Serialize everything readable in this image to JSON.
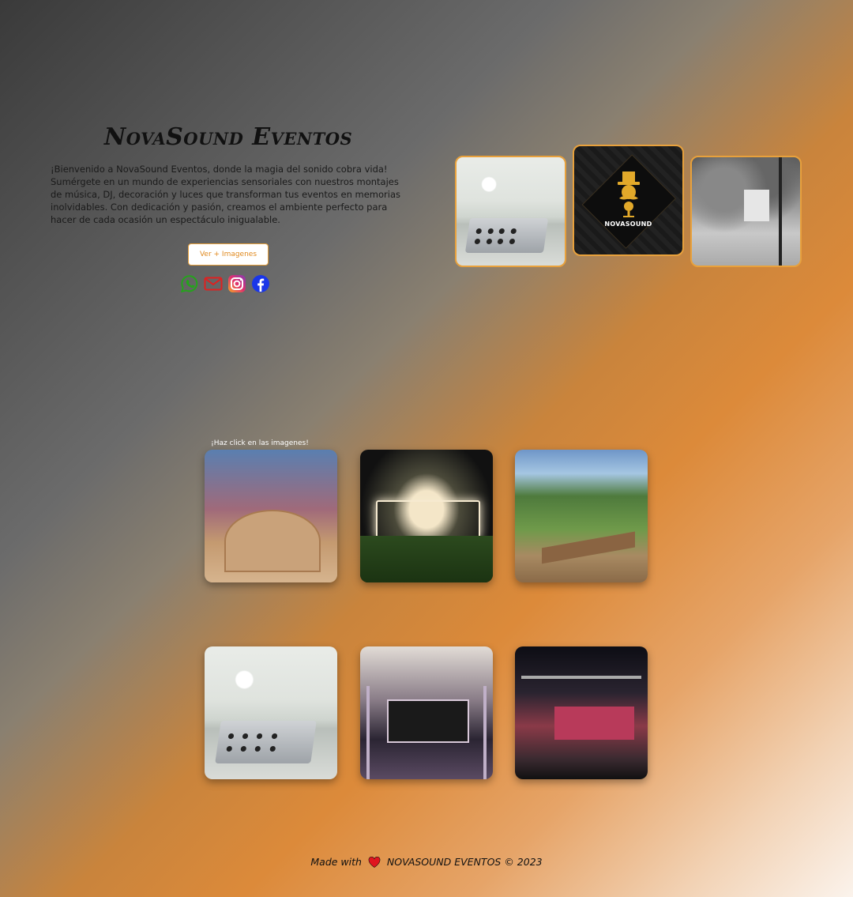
{
  "hero": {
    "title": "NovaSound Eventos",
    "description": "¡Bienvenido a NovaSound Eventos, donde la magia del sonido cobra vida! Sumérgete en un mundo de experiencias sensoriales con nuestros montajes de música, DJ, decoración y luces que transforman tus eventos en memorias inolvidables. Con dedicación y pasión, creamos el ambiente perfecto para hacer de cada ocasión un espectáculo inigualable.",
    "more_button": "Ver + Imagenes",
    "logo_text": "NOVASOUND"
  },
  "social": [
    {
      "icon": "whatsapp-icon",
      "color": "#25a31c"
    },
    {
      "icon": "mail-icon",
      "color": "#e02020"
    },
    {
      "icon": "instagram-icon",
      "color": "#d6249f"
    },
    {
      "icon": "facebook-icon",
      "color": "#1a36e8"
    }
  ],
  "gallery": {
    "hint": "¡Haz click en las imagenes!"
  },
  "footer": {
    "made_with": "Made with",
    "brand": "NOVASOUND EVENTOS © 2023"
  },
  "colors": {
    "accent": "#e8a13c",
    "logo_gold": "#e2a92a"
  }
}
